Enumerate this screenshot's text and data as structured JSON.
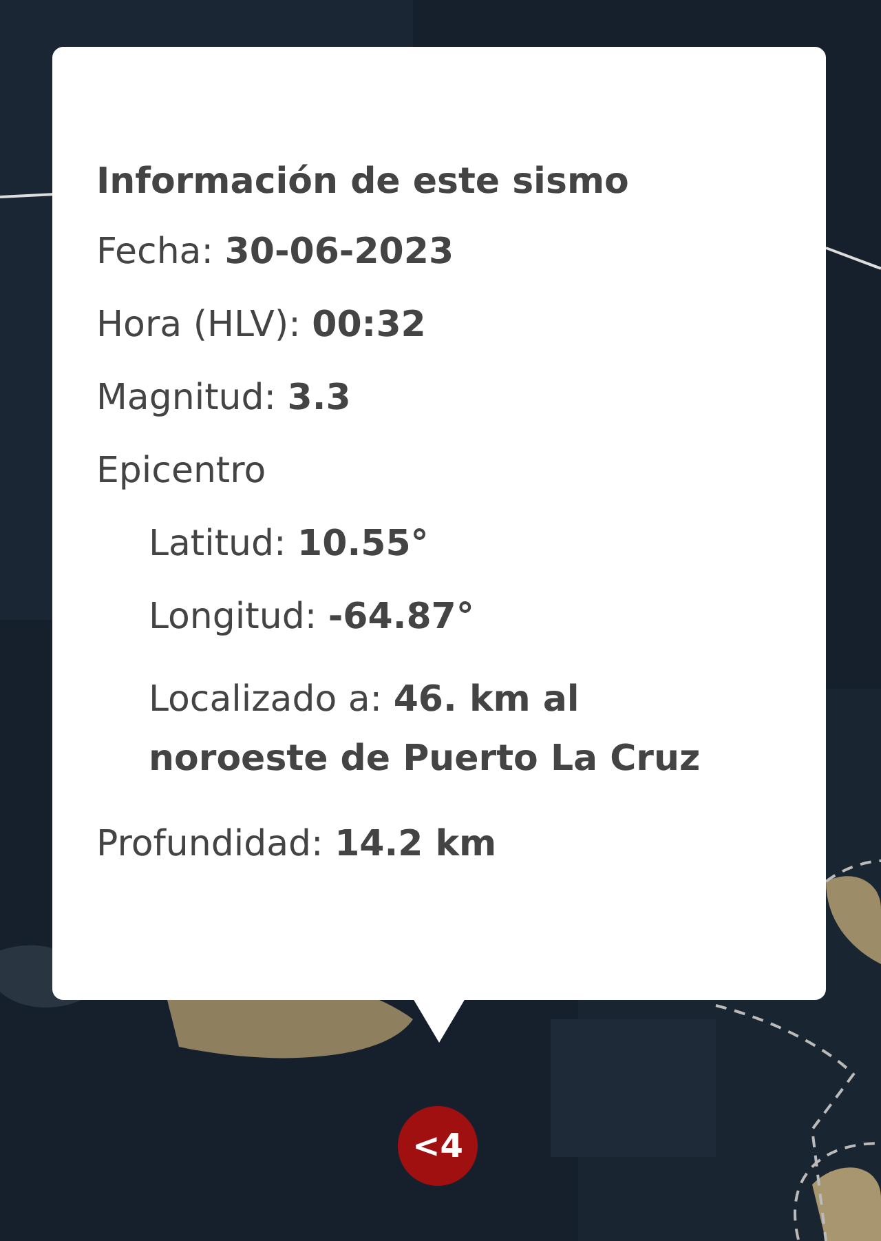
{
  "popup": {
    "title": "Información de este sismo",
    "lines": [
      {
        "text": "Fecha: **30-06-2023**"
      },
      {
        "text": "Hora (HLV): **00:32**"
      },
      {
        "text": "Magnitud: **3.3**"
      },
      {
        "text": "Epicentro",
        "children": [
          {
            "text": "Latitud: **10.55°**"
          },
          {
            "text": "Longitud: **-64.87°**"
          },
          {
            "text": "Localizado a: **46. km al noroeste de Puerto La Cruz**"
          }
        ]
      },
      {
        "text": "Profundidad: **14.2 km**"
      }
    ]
  },
  "marker": {
    "label": "<4"
  }
}
